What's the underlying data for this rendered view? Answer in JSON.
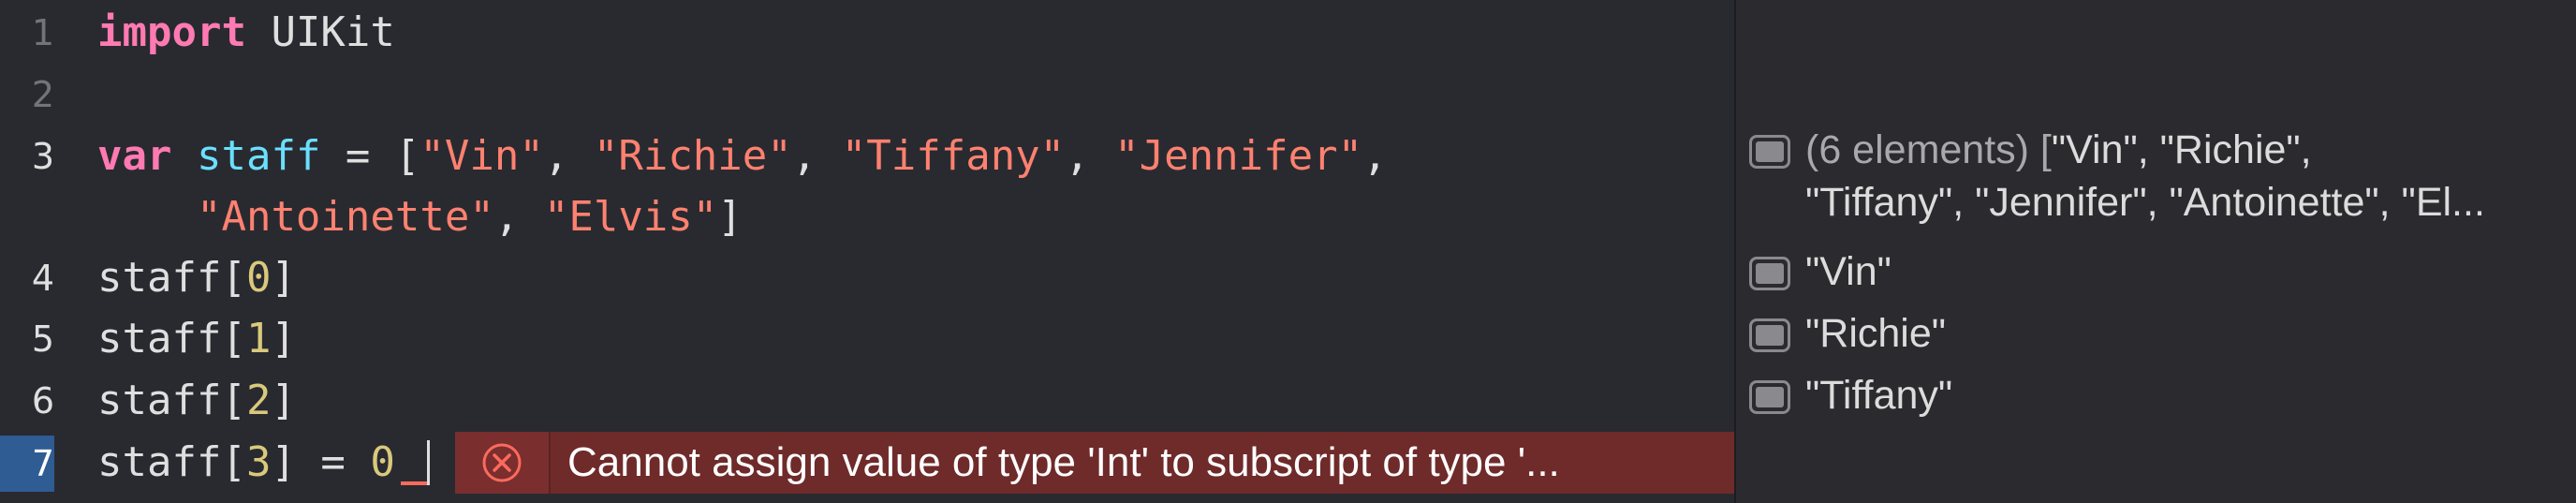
{
  "editor": {
    "lines": [
      {
        "number": "1",
        "tokens": [
          {
            "t": "kw",
            "v": "import"
          },
          {
            "t": "plain",
            "v": " UIKit"
          }
        ]
      },
      {
        "number": "2",
        "tokens": []
      },
      {
        "number": "3",
        "tokens": [
          {
            "t": "kw",
            "v": "var"
          },
          {
            "t": "plain",
            "v": " "
          },
          {
            "t": "var",
            "v": "staff"
          },
          {
            "t": "plain",
            "v": " = ["
          },
          {
            "t": "str",
            "v": "\"Vin\""
          },
          {
            "t": "plain",
            "v": ", "
          },
          {
            "t": "str",
            "v": "\"Richie\""
          },
          {
            "t": "plain",
            "v": ", "
          },
          {
            "t": "str",
            "v": "\"Tiffany\""
          },
          {
            "t": "plain",
            "v": ", "
          },
          {
            "t": "str",
            "v": "\"Jennifer\""
          },
          {
            "t": "plain",
            "v": ","
          }
        ]
      },
      {
        "number": "",
        "tokens": [
          {
            "t": "plain",
            "v": "    "
          },
          {
            "t": "str",
            "v": "\"Antoinette\""
          },
          {
            "t": "plain",
            "v": ", "
          },
          {
            "t": "str",
            "v": "\"Elvis\""
          },
          {
            "t": "plain",
            "v": "]"
          }
        ]
      },
      {
        "number": "4",
        "tokens": [
          {
            "t": "plain",
            "v": "staff["
          },
          {
            "t": "num",
            "v": "0"
          },
          {
            "t": "plain",
            "v": "]"
          }
        ]
      },
      {
        "number": "5",
        "tokens": [
          {
            "t": "plain",
            "v": "staff["
          },
          {
            "t": "num",
            "v": "1"
          },
          {
            "t": "plain",
            "v": "]"
          }
        ]
      },
      {
        "number": "6",
        "tokens": [
          {
            "t": "plain",
            "v": "staff["
          },
          {
            "t": "num",
            "v": "2"
          },
          {
            "t": "plain",
            "v": "]"
          }
        ]
      }
    ],
    "active_line": {
      "number": "7",
      "tokens": [
        {
          "t": "plain",
          "v": "staff["
        },
        {
          "t": "num",
          "v": "3"
        },
        {
          "t": "plain",
          "v": "] = "
        },
        {
          "t": "num",
          "v": "0"
        }
      ]
    },
    "error": {
      "icon": "error-x-icon",
      "message": "Cannot assign value of type 'Int' to subscript of type '..."
    }
  },
  "results": {
    "rows": [
      {
        "line1_muted": "(6 elements) [",
        "line1": "\"Vin\", \"Richie\",",
        "line2": "\"Tiffany\", \"Jennifer\", \"Antoinette\", \"El..."
      },
      {
        "text": "\"Vin\""
      },
      {
        "text": "\"Richie\""
      },
      {
        "text": "\"Tiffany\""
      }
    ],
    "icon": "quick-look-icon"
  },
  "colors": {
    "background": "#292a30",
    "keyword": "#ff7ab2",
    "identifier": "#6bdfff",
    "string": "#ff8170",
    "number": "#d9c97c",
    "error_banner": "#6f2a2a",
    "active_line_gutter": "#2f5c93"
  }
}
